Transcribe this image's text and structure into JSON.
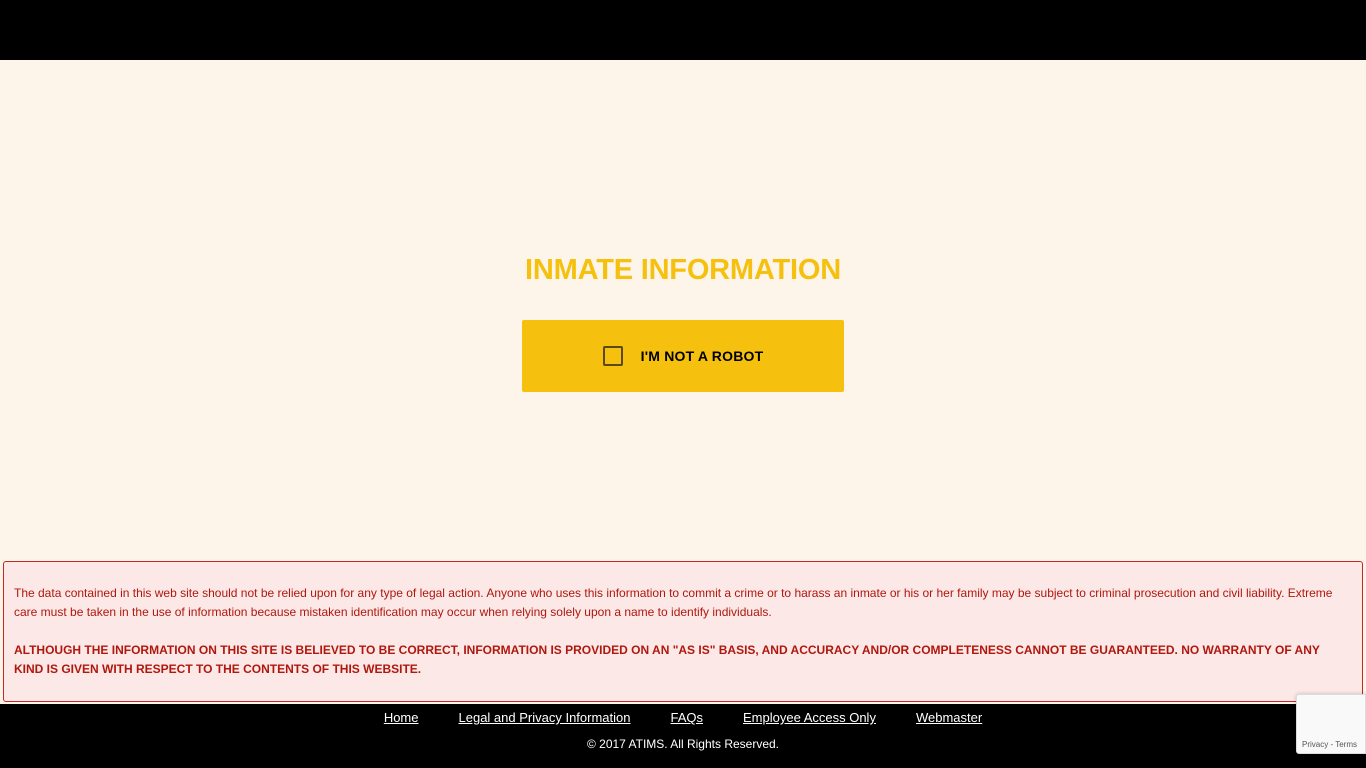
{
  "main": {
    "title": "INMATE INFORMATION",
    "robot_check_label": "I'M NOT A ROBOT"
  },
  "disclaimer": {
    "text": "The data contained in this web site should not be relied upon for any type of legal action. Anyone who uses this information to commit a crime or to harass an inmate or his or her family may be subject to criminal prosecution and civil liability. Extreme care must be taken in the use of information because mistaken identification may occur when relying solely upon a name to identify individuals.",
    "warning": "ALTHOUGH THE INFORMATION ON THIS SITE IS BELIEVED TO BE CORRECT, INFORMATION IS PROVIDED ON AN \"AS IS\" BASIS, AND ACCURACY AND/OR COMPLETENESS CANNOT BE GUARANTEED. NO WARRANTY OF ANY KIND IS GIVEN WITH RESPECT TO THE CONTENTS OF THIS WEBSITE."
  },
  "footer": {
    "links": [
      {
        "label": "Home"
      },
      {
        "label": "Legal and Privacy Information"
      },
      {
        "label": "FAQs"
      },
      {
        "label": "Employee Access Only"
      },
      {
        "label": "Webmaster"
      }
    ],
    "copyright": "© 2017 ATIMS. All Rights Reserved."
  },
  "recaptcha": {
    "privacy_label": "Privacy",
    "separator": " - ",
    "terms_label": "Terms"
  },
  "colors": {
    "accent": "#F5C10E",
    "background": "#FEF5EA",
    "disclaimer_text": "#B0170E",
    "disclaimer_bg": "#FCE8E6",
    "bar": "#000000"
  }
}
